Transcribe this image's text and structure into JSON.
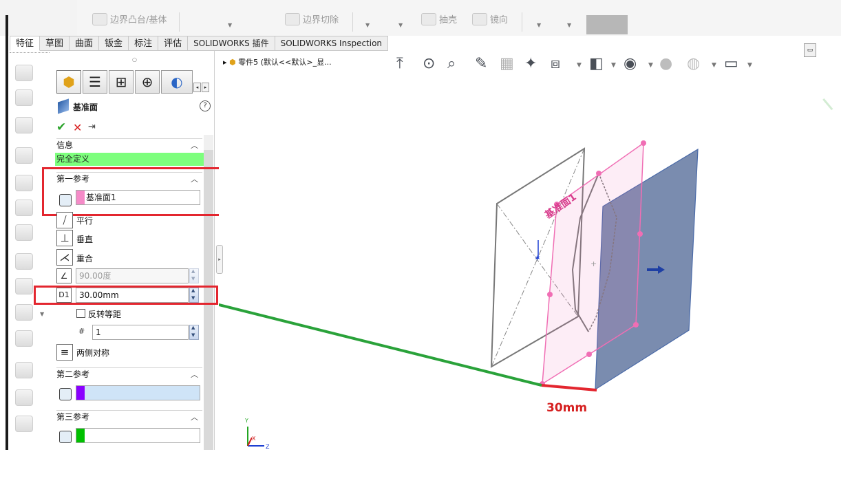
{
  "toolbar": {
    "boundary_boss": "边界凸台/基体",
    "boundary_cut": "边界切除",
    "shell": "抽壳",
    "mirror": "镜向"
  },
  "tabs": [
    {
      "label": "特征"
    },
    {
      "label": "草图"
    },
    {
      "label": "曲面"
    },
    {
      "label": "钣金"
    },
    {
      "label": "标注"
    },
    {
      "label": "评估"
    },
    {
      "label": "SOLIDWORKS 插件"
    },
    {
      "label": "SOLIDWORKS Inspection"
    }
  ],
  "breadcrumb": "零件5 (默认<<默认>_显...",
  "property_manager": {
    "title": "基准面",
    "help": "?",
    "ok": "✔",
    "cancel": "✕",
    "pin": "⇥",
    "message_header": "信息",
    "message": "完全定义",
    "first_reference": {
      "header": "第一参考",
      "selection": "基准面1",
      "swatch_color": "#f58bc8",
      "options": [
        "平行",
        "垂直",
        "重合"
      ],
      "angle_value": "90.00度",
      "distance_value": "30.00mm",
      "flip_offset": "反转等距",
      "instances": "1",
      "mid_plane": "两侧对称"
    },
    "second_reference": {
      "header": "第二参考",
      "selection": "",
      "swatch_color": "#8a00ff"
    },
    "third_reference": {
      "header": "第三参考",
      "selection": "",
      "swatch_color": "#00c000"
    }
  },
  "annotation": {
    "distance_text": "30mm",
    "text_color": "#d62020",
    "leader_color": "#2aa23a"
  },
  "model": {
    "preview_plane_label": "基准面1",
    "plane_fill": "#6b7fa6",
    "preview_color": "#f06eb4"
  },
  "triad": {
    "y": "Y",
    "x": "X",
    "z": "Z"
  }
}
